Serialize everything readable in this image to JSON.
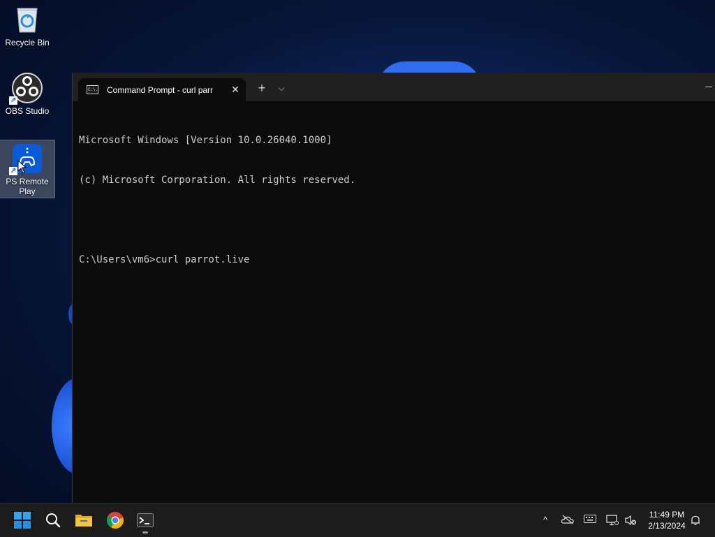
{
  "desktop": {
    "icons": [
      {
        "label": "Recycle Bin"
      },
      {
        "label": "OBS Studio"
      },
      {
        "label": "PS Remote Play"
      }
    ]
  },
  "terminal": {
    "tab_title": "Command Prompt - curl  parr",
    "tab_icon_text": "C:\\.",
    "close_glyph": "✕",
    "newtab_glyph": "+",
    "dropdown_glyph": "⌵",
    "lines": [
      "Microsoft Windows [Version 10.0.26040.1000]",
      "(c) Microsoft Corporation. All rights reserved.",
      "",
      "C:\\Users\\vm6>curl parrot.live"
    ]
  },
  "taskbar": {
    "apps": [
      "start-icon",
      "search-icon",
      "file-explorer-icon",
      "chrome-icon",
      "terminal-icon"
    ],
    "tray": {
      "chevron": "^",
      "icons": [
        "onedrive-icon",
        "keyboard-icon",
        "network-icon",
        "volume-muted-icon"
      ]
    },
    "time": "11:49 PM",
    "date": "2/13/2024"
  },
  "colors": {
    "accent": "#0078d4",
    "console_bg": "#0c0c0c",
    "console_text": "#cccccc",
    "titlebar": "#202020",
    "taskbar": "#1c1c1c"
  }
}
